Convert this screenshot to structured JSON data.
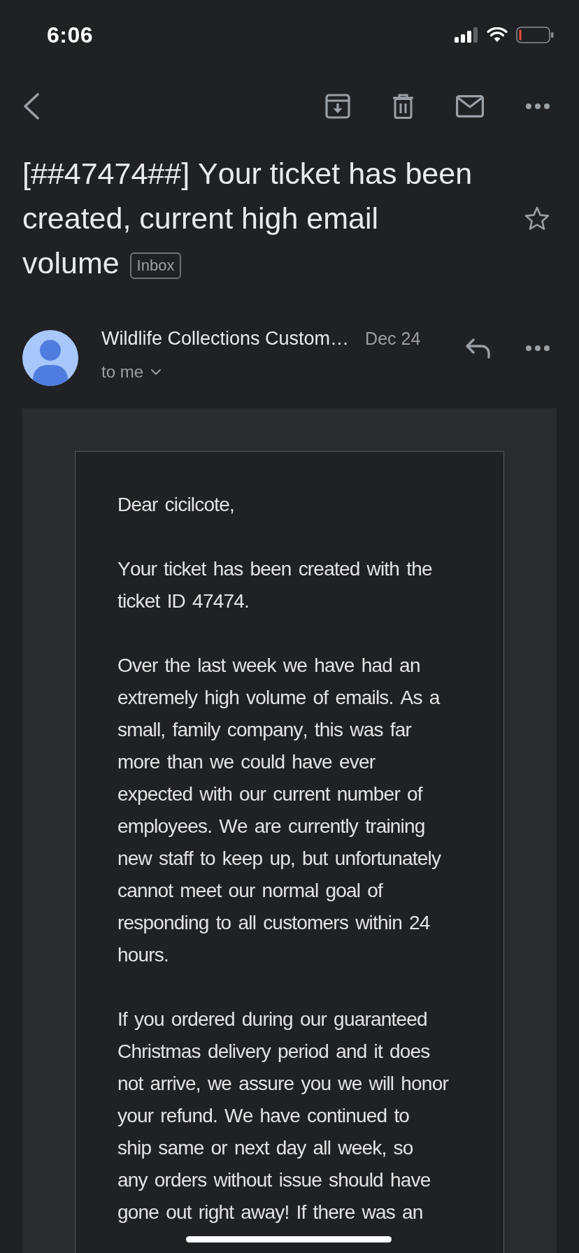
{
  "status_bar": {
    "time": "6:06"
  },
  "subject": {
    "text": "[##47474##] Your ticket has been created, current high email volume",
    "label": "Inbox",
    "starred": false
  },
  "message": {
    "sender": "Wildlife Collections Custom…",
    "date": "Dec 24",
    "recipient": "to me",
    "body": [
      "Dear cicilcote,",
      "Your ticket has been created with the ticket ID 47474.",
      "Over the last week we have had an extremely high volume of emails. As a small, family company, this was far more than we could have ever expected with our current number of employees. We are currently training new staff to keep up, but unfortunately cannot meet our normal goal of responding to all customers within 24 hours.",
      "If you ordered during our guaranteed Christmas delivery period and it does not arrive, we assure you we will honor your refund. We have continued to ship same or next day all week, so any orders without issue should have gone out right away! If there was an"
    ]
  }
}
